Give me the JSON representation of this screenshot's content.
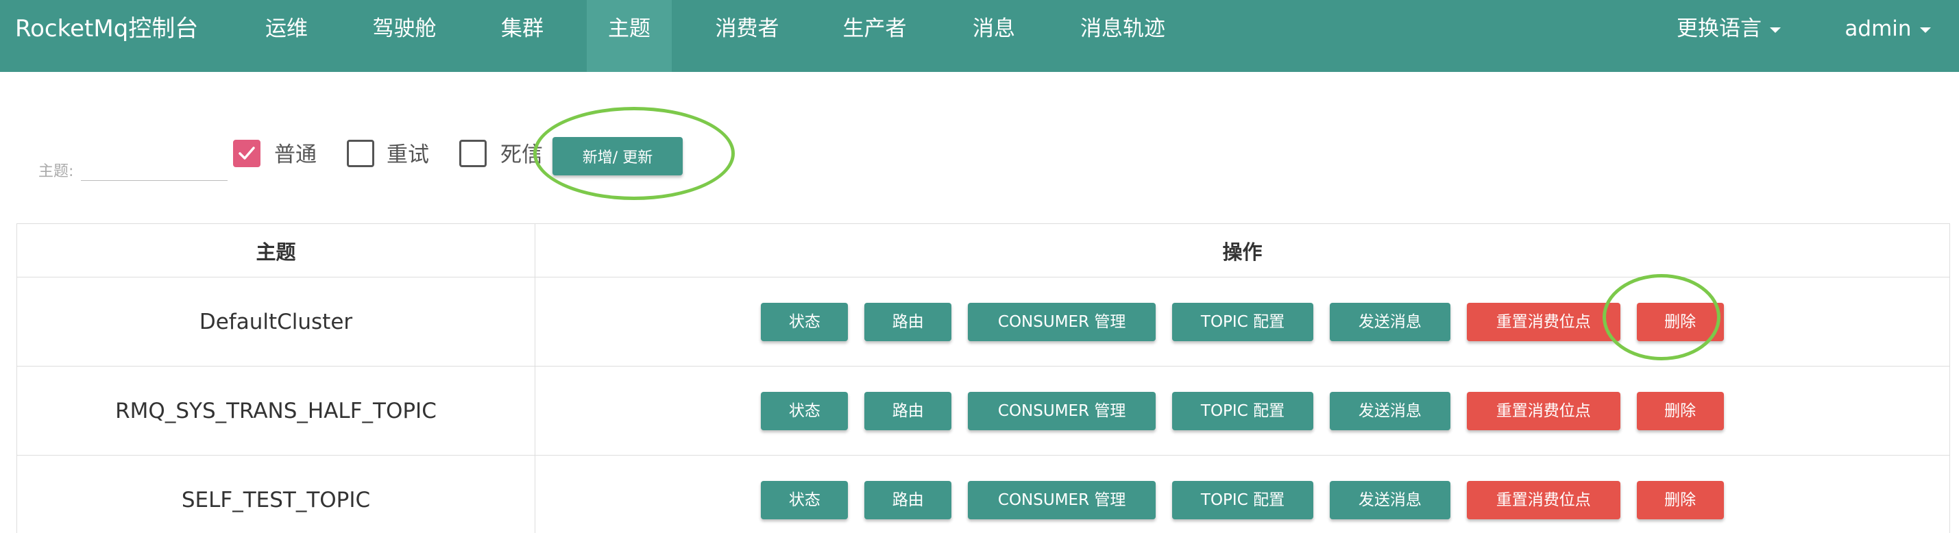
{
  "navbar": {
    "brand": "RocketMq控制台",
    "items": [
      "运维",
      "驾驶舱",
      "集群",
      "主题",
      "消费者",
      "生产者",
      "消息",
      "消息轨迹"
    ],
    "active": "主题",
    "language": "更换语言",
    "user": "admin"
  },
  "filter": {
    "label": "主题:",
    "input_value": "",
    "checkboxes": [
      {
        "label": "普通",
        "checked": true
      },
      {
        "label": "重试",
        "checked": false
      },
      {
        "label": "死信",
        "checked": false
      }
    ],
    "add_button": "新增/ 更新"
  },
  "table": {
    "headers": [
      "主题",
      "操作"
    ],
    "actions": [
      "状态",
      "路由",
      "CONSUMER 管理",
      "TOPIC 配置",
      "发送消息",
      "重置消费位点",
      "删除"
    ],
    "rows": [
      {
        "topic": "DefaultCluster"
      },
      {
        "topic": "RMQ_SYS_TRANS_HALF_TOPIC"
      },
      {
        "topic": "SELF_TEST_TOPIC"
      }
    ]
  },
  "colors": {
    "primary": "#41968a",
    "danger": "#e5534b",
    "checkbox_checked": "#e25a7d",
    "highlight": "#7cc94a"
  }
}
